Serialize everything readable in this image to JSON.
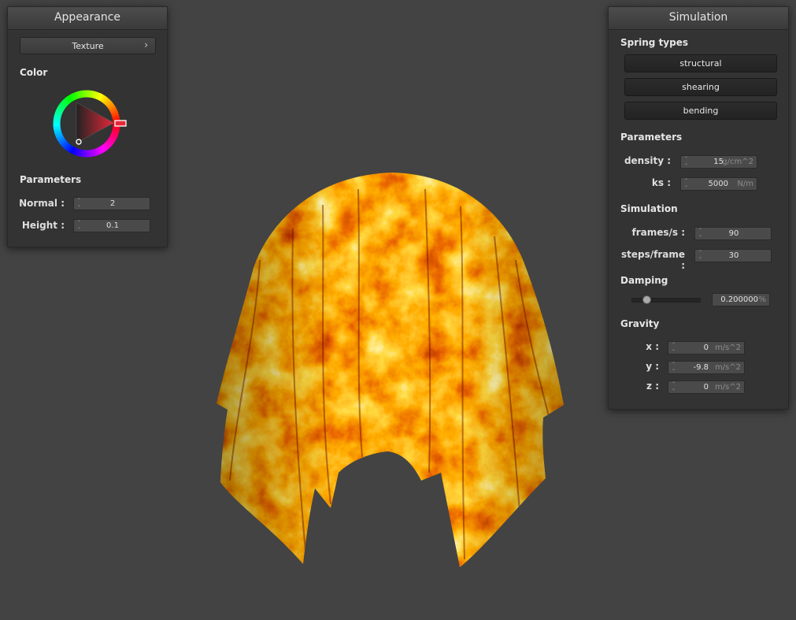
{
  "appearance": {
    "title": "Appearance",
    "texture_button": "Texture",
    "chevron": "›",
    "color_heading": "Color",
    "color_value": "#e8283a",
    "parameters_heading": "Parameters",
    "normal_label": "Normal :",
    "normal_value": "2",
    "height_label": "Height :",
    "height_value": "0.1"
  },
  "simulation": {
    "title": "Simulation",
    "spring_types_heading": "Spring types",
    "spring_types": [
      "structural",
      "shearing",
      "bending"
    ],
    "parameters_heading": "Parameters",
    "density_label": "density :",
    "density_value": "15",
    "density_unit": "g/cm^2",
    "ks_label": "ks :",
    "ks_value": "5000",
    "ks_unit": "N/m",
    "simulation_heading": "Simulation",
    "fps_label": "frames/s :",
    "fps_value": "90",
    "steps_label": "steps/frame :",
    "steps_value": "30",
    "damping_heading": "Damping",
    "damping_value": "0.200000",
    "damping_unit": "%",
    "damping_fraction": 0.2,
    "gravity_heading": "Gravity",
    "gx_label": "x :",
    "gx_value": "0",
    "gy_label": "y :",
    "gy_value": "-9.8",
    "gz_label": "z :",
    "gz_value": "0",
    "gravity_unit": "m/s^2"
  },
  "colors": {
    "background": "#434343",
    "panel": "#333333",
    "cloth_light": "#fff3a0",
    "cloth_mid": "#f07010",
    "cloth_dark": "#8a1400"
  }
}
